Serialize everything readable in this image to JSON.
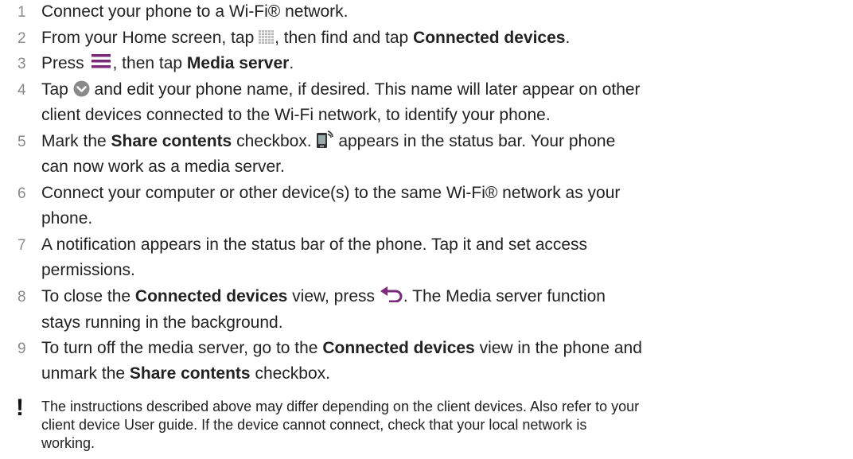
{
  "steps": [
    {
      "n": "1",
      "lines": [
        [
          {
            "t": "Connect your phone to a Wi-Fi® network."
          }
        ]
      ]
    },
    {
      "n": "2",
      "lines": [
        [
          {
            "t": "From your Home screen, tap "
          },
          {
            "icon": "apps-grid-icon"
          },
          {
            "t": ", then find and tap "
          },
          {
            "t": "Connected devices",
            "b": true
          },
          {
            "t": "."
          }
        ]
      ]
    },
    {
      "n": "3",
      "lines": [
        [
          {
            "t": "Press "
          },
          {
            "icon": "menu-icon"
          },
          {
            "t": ", then tap "
          },
          {
            "t": "Media server",
            "b": true
          },
          {
            "t": "."
          }
        ]
      ]
    },
    {
      "n": "4",
      "lines": [
        [
          {
            "t": "Tap "
          },
          {
            "icon": "chevron-down-icon"
          },
          {
            "t": " and edit your phone name, if desired. This name will later appear on other"
          }
        ],
        [
          {
            "t": "client devices connected to the Wi-Fi network, to identify your phone."
          }
        ]
      ]
    },
    {
      "n": "5",
      "lines": [
        [
          {
            "t": "Mark the "
          },
          {
            "t": "Share contents",
            "b": true
          },
          {
            "t": " checkbox. "
          },
          {
            "icon": "media-server-status-icon"
          },
          {
            "t": " appears in the status bar. Your phone"
          }
        ],
        [
          {
            "t": "can now work as a media server."
          }
        ]
      ]
    },
    {
      "n": "6",
      "lines": [
        [
          {
            "t": "Connect your computer or other device(s) to the same Wi-Fi® network as your"
          }
        ],
        [
          {
            "t": "phone."
          }
        ]
      ]
    },
    {
      "n": "7",
      "lines": [
        [
          {
            "t": "A notification appears in the status bar of the phone. Tap it and set access"
          }
        ],
        [
          {
            "t": "permissions."
          }
        ]
      ]
    },
    {
      "n": "8",
      "lines": [
        [
          {
            "t": "To close the "
          },
          {
            "t": "Connected devices",
            "b": true
          },
          {
            "t": " view, press "
          },
          {
            "icon": "back-icon"
          },
          {
            "t": ". The Media server function"
          }
        ],
        [
          {
            "t": "stays running in the background."
          }
        ]
      ]
    },
    {
      "n": "9",
      "lines": [
        [
          {
            "t": "To turn off the media server, go to the "
          },
          {
            "t": "Connected devices",
            "b": true
          },
          {
            "t": " view in the phone and"
          }
        ],
        [
          {
            "t": "unmark the "
          },
          {
            "t": "Share contents",
            "b": true
          },
          {
            "t": " checkbox."
          }
        ]
      ]
    }
  ],
  "note": {
    "icon": "exclamation-icon",
    "mark": "!",
    "lines": [
      "The instructions described above may differ depending on the client devices. Also refer to your",
      "client device User guide. If the device cannot connect, check that your local network is",
      "working."
    ]
  },
  "colors": {
    "text": "#222222",
    "step_number": "#8a8a8a",
    "accent_purple": "#7b2a7b",
    "chevron_gray": "#8a8a8a"
  }
}
